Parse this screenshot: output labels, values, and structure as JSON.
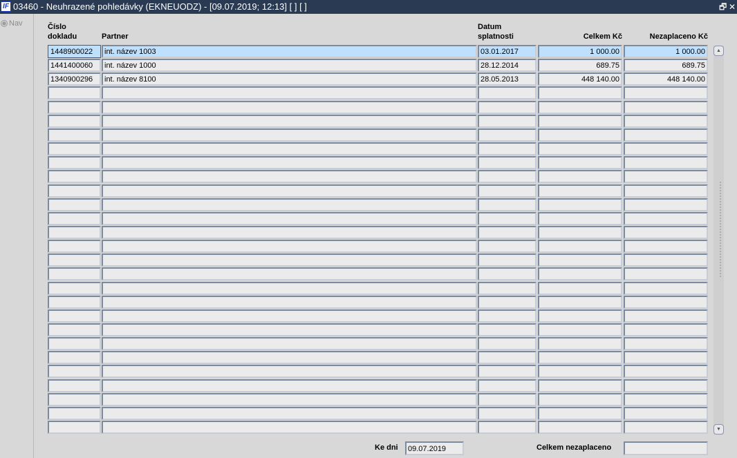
{
  "window": {
    "logo": "IF",
    "title": "03460 - Neuhrazené pohledávky (EKNEUODZ) - [09.07.2019; 12:13]  [ ]  [ ]",
    "restore_icon": "restore-icon",
    "close_icon": "close-icon",
    "restore": "🗗",
    "close": "✕"
  },
  "nav": {
    "label": "Nav"
  },
  "headers": {
    "doc_line1": "Číslo",
    "doc_line2": "dokladu",
    "partner": "Partner",
    "date_line1": "Datum",
    "date_line2": "splatnosti",
    "total": "Celkem Kč",
    "unpaid": "Nezaplaceno Kč"
  },
  "rows": [
    {
      "doc": "1448900022",
      "partner": "int. název 1003",
      "due": "03.01.2017",
      "total": "1 000.00",
      "unpaid": "1 000.00"
    },
    {
      "doc": "1441400060",
      "partner": "int. název 1000",
      "due": "28.12.2014",
      "total": "689.75",
      "unpaid": "689.75"
    },
    {
      "doc": "1340900296",
      "partner": "int. název 8100",
      "due": "28.05.2013",
      "total": "448 140.00",
      "unpaid": "448 140.00"
    }
  ],
  "empty_row_count": 25,
  "footer": {
    "as_of_label": "Ke dni",
    "as_of_value": "09.07.2019",
    "total_unpaid_label": "Celkem nezaplaceno",
    "total_unpaid_value": ""
  }
}
